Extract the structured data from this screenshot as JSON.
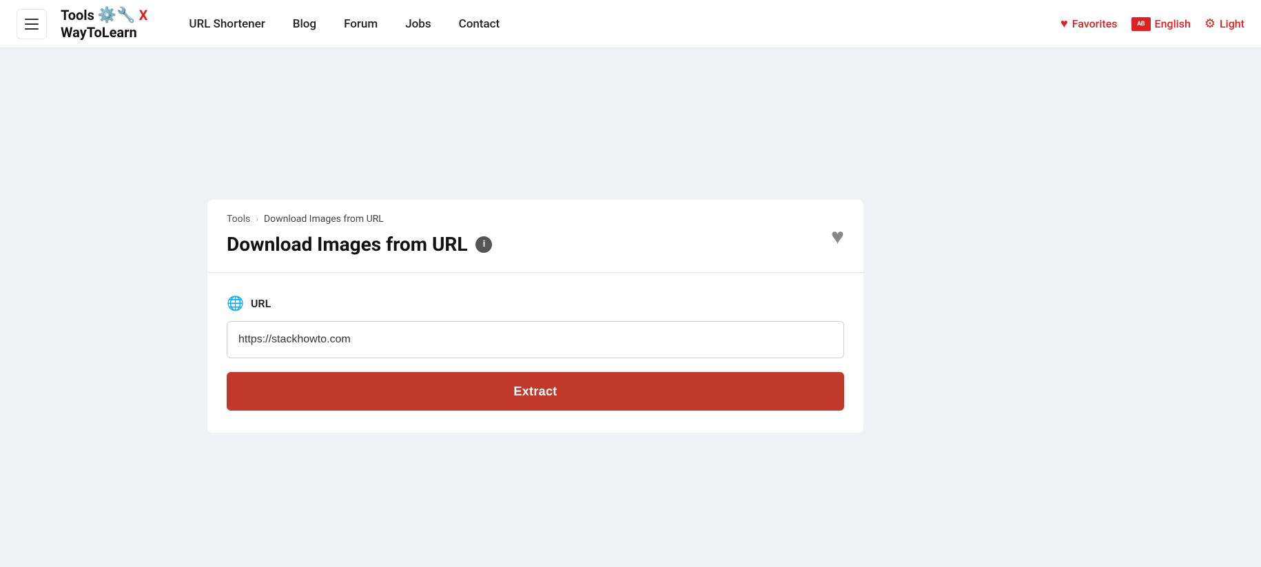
{
  "header": {
    "hamburger_label": "menu",
    "logo": {
      "line1": "Tools",
      "line2": "WayToLearn",
      "x_letter": "X"
    },
    "nav": {
      "items": [
        {
          "label": "URL Shortener",
          "id": "url-shortener"
        },
        {
          "label": "Blog",
          "id": "blog"
        },
        {
          "label": "Forum",
          "id": "forum"
        },
        {
          "label": "Jobs",
          "id": "jobs"
        },
        {
          "label": "Contact",
          "id": "contact"
        }
      ]
    },
    "favorites_label": "Favorites",
    "language_label": "English",
    "language_icon_text": "AB",
    "theme_label": "Light"
  },
  "breadcrumb": {
    "root": "Tools",
    "current": "Download Images from URL"
  },
  "page": {
    "title": "Download Images from URL",
    "info_icon_label": "i"
  },
  "tool": {
    "url_label": "URL",
    "url_placeholder": "https://stackhowto.com",
    "url_value": "https://stackhowto.com",
    "extract_button_label": "Extract"
  }
}
